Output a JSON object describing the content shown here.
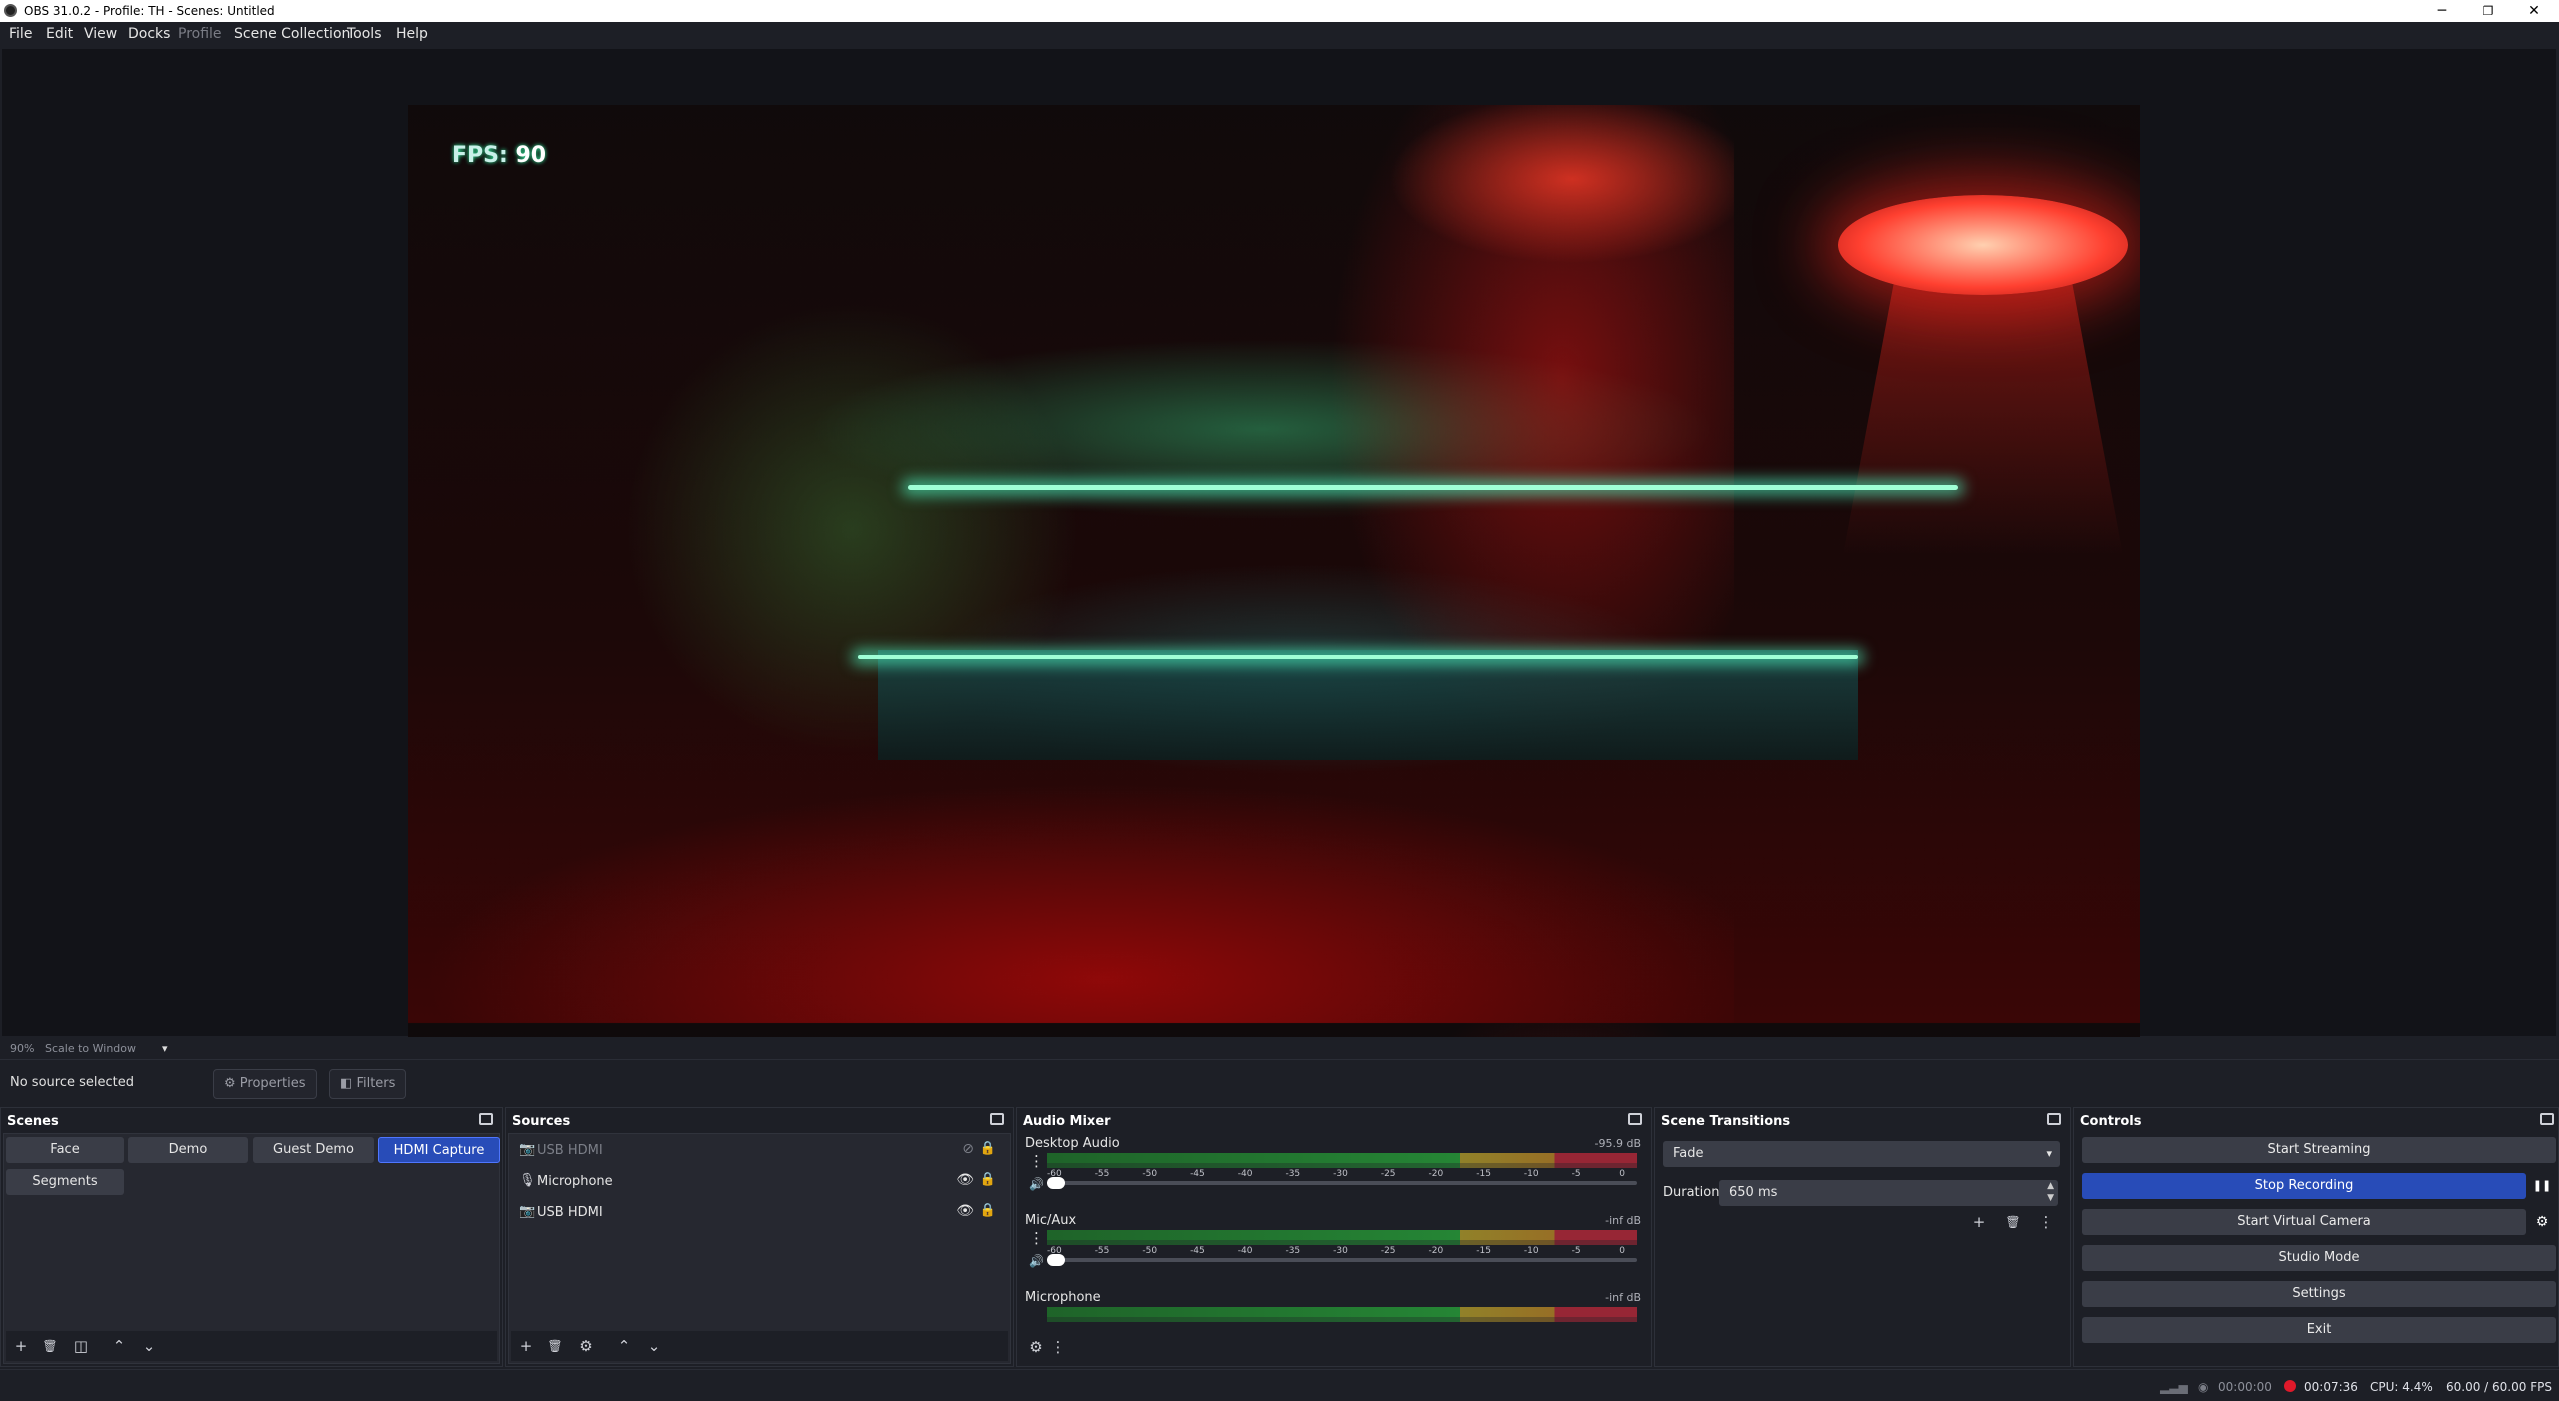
{
  "window": {
    "title": "OBS 31.0.2 - Profile: TH - Scenes: Untitled",
    "minimize": "─",
    "restore": "❐",
    "close": "✕"
  },
  "menu": [
    "File",
    "Edit",
    "View",
    "Docks",
    "Profile",
    "Scene Collection",
    "Tools",
    "Help"
  ],
  "preview": {
    "fps_label": "FPS:",
    "fps_value": "90"
  },
  "zoom": {
    "percent": "90%",
    "mode": "Scale to Window",
    "caret": "▾"
  },
  "source_toolbar": {
    "status": "No source selected",
    "properties": "Properties",
    "filters": "Filters",
    "properties_icon": "⚙",
    "filters_icon": "◧"
  },
  "scenes": {
    "title": "Scenes",
    "items": [
      {
        "label": "Face",
        "active": false
      },
      {
        "label": "Demo",
        "active": false
      },
      {
        "label": "Guest Demo",
        "active": false
      },
      {
        "label": "HDMI Capture",
        "active": true
      },
      {
        "label": "Segments",
        "active": false
      }
    ],
    "tools": [
      "+",
      "🗑",
      "◫",
      "⌃",
      "⌄"
    ]
  },
  "sources": {
    "title": "Sources",
    "items": [
      {
        "label": "USB HDMI",
        "icon": "camera-icon",
        "visible": false
      },
      {
        "label": "Microphone",
        "icon": "microphone-icon",
        "visible": true
      },
      {
        "label": "USB HDMI",
        "icon": "camera-icon",
        "visible": true
      }
    ],
    "tools": [
      "+",
      "🗑",
      "⚙",
      "⌃",
      "⌄"
    ]
  },
  "mixer": {
    "title": "Audio Mixer",
    "ticks": [
      "-60",
      "-55",
      "-50",
      "-45",
      "-40",
      "-35",
      "-30",
      "-25",
      "-20",
      "-15",
      "-10",
      "-5",
      "0"
    ],
    "tracks": [
      {
        "name": "Desktop Audio",
        "db": "-95.9 dB"
      },
      {
        "name": "Mic/Aux",
        "db": "-inf dB"
      },
      {
        "name": "Microphone",
        "db": "-inf dB"
      }
    ],
    "tools": [
      "⚙",
      "⋮"
    ]
  },
  "transitions": {
    "title": "Scene Transitions",
    "selected": "Fade",
    "duration_label": "Duration",
    "duration_value": "650 ms",
    "tools": [
      "+",
      "🗑",
      "⋮"
    ]
  },
  "controls": {
    "title": "Controls",
    "buttons": [
      {
        "label": "Start Streaming",
        "active": false
      },
      {
        "label": "Stop Recording",
        "active": true
      },
      {
        "label": "Start Virtual Camera",
        "active": false
      },
      {
        "label": "Studio Mode",
        "active": false
      },
      {
        "label": "Settings",
        "active": false
      },
      {
        "label": "Exit",
        "active": false
      }
    ],
    "pause_icon": "❚❚",
    "vcam_settings_icon": "⚙"
  },
  "status": {
    "stream_time": "00:00:00",
    "rec_time": "00:07:36",
    "cpu": "CPU: 4.4%",
    "fps": "60.00 / 60.00 FPS"
  },
  "colors": {
    "accent": "#284cb8",
    "record": "#e0192a",
    "bg": "#1d1f26"
  }
}
